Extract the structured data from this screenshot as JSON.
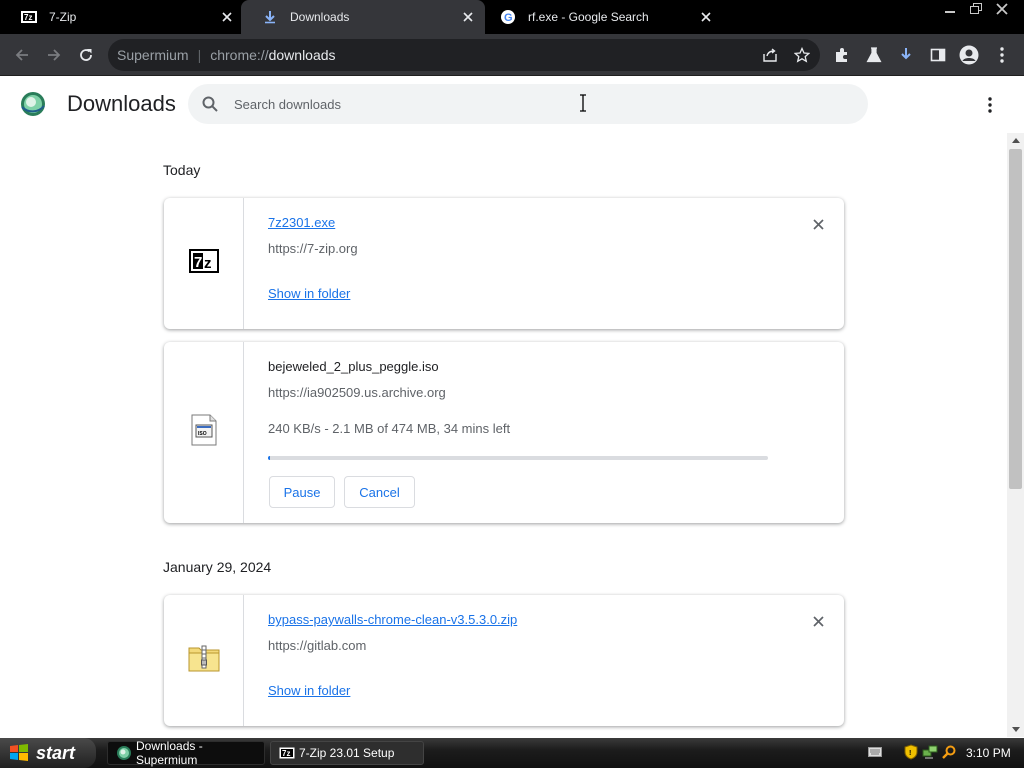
{
  "window": {
    "tabs": [
      {
        "title": "7-Zip",
        "favicon": "7zip-icon",
        "active": false
      },
      {
        "title": "Downloads",
        "favicon": "download-icon",
        "active": true
      },
      {
        "title": "rf.exe - Google Search",
        "favicon": "google-icon",
        "active": false
      }
    ],
    "controls": [
      "minimize-icon",
      "restore-icon",
      "close-icon"
    ]
  },
  "toolbar": {
    "omnibox": {
      "site": "Supermium",
      "scheme": "chrome://",
      "path": "downloads"
    },
    "icons": [
      "back-icon",
      "forward-icon",
      "reload-icon",
      "share-icon",
      "bookmark-star-icon",
      "extensions-icon",
      "labs-flask-icon",
      "downloads-icon",
      "side-panel-icon",
      "profile-icon",
      "menu-icon"
    ]
  },
  "downloads_page": {
    "title": "Downloads",
    "search_placeholder": "Search downloads",
    "groups": [
      {
        "date": "Today",
        "items": [
          {
            "file_name": "7z2301.exe",
            "url": "https://7-zip.org",
            "icon": "7zip-file-icon",
            "action": "Show in folder",
            "state": "complete"
          },
          {
            "file_name": "bejeweled_2_plus_peggle.iso",
            "url": "https://ia902509.us.archive.org",
            "icon": "disc-image-file-icon",
            "status": "240 KB/s - 2.1 MB of 474 MB, 34 mins left",
            "progress": 0.0044,
            "pause_label": "Pause",
            "cancel_label": "Cancel",
            "state": "in-progress"
          }
        ]
      },
      {
        "date": "January 29, 2024",
        "items": [
          {
            "file_name": "bypass-paywalls-chrome-clean-v3.5.3.0.zip",
            "url": "https://gitlab.com",
            "icon": "zip-folder-icon",
            "action": "Show in folder",
            "state": "complete"
          }
        ]
      }
    ]
  },
  "taskbar": {
    "start_label": "start",
    "items": [
      {
        "label": "Downloads - Supermium",
        "icon": "supermium-icon",
        "active": true
      },
      {
        "label": "7-Zip 23.01 Setup",
        "icon": "7zip-icon",
        "active": false
      }
    ],
    "clock": "3:10 PM"
  },
  "colors": {
    "accent": "#1a73e8",
    "tabstrip": "#000000",
    "toolbar": "#35363a",
    "omnibox": "#202124"
  }
}
